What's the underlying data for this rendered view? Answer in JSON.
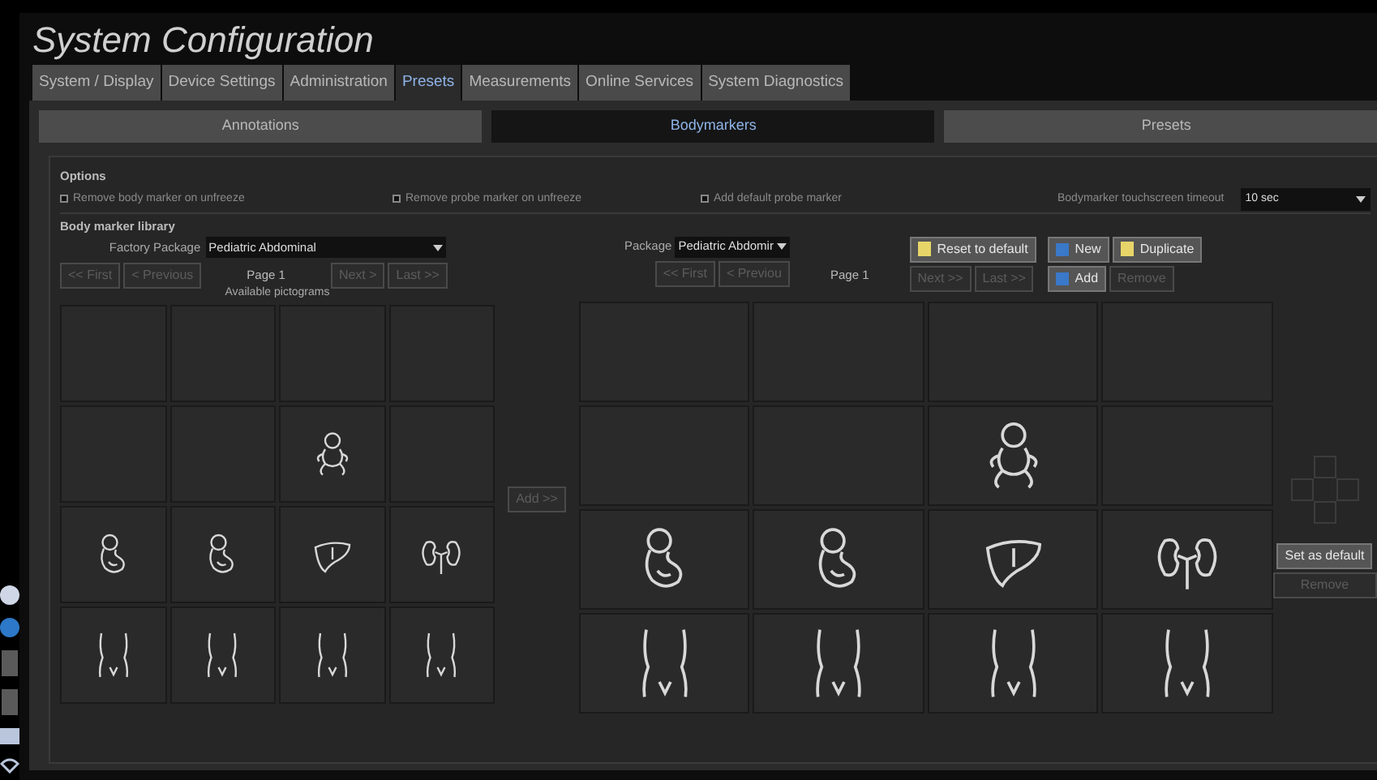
{
  "title": "System Configuration",
  "tabs": [
    {
      "label": "System / Display",
      "selected": false
    },
    {
      "label": "Device Settings",
      "selected": false
    },
    {
      "label": "Administration",
      "selected": false
    },
    {
      "label": "Presets",
      "selected": true
    },
    {
      "label": "Measurements",
      "selected": false
    },
    {
      "label": "Online Services",
      "selected": false
    },
    {
      "label": "System Diagnostics",
      "selected": false
    }
  ],
  "subtabs": [
    {
      "label": "Annotations",
      "selected": false
    },
    {
      "label": "Bodymarkers",
      "selected": true
    },
    {
      "label": "Presets",
      "selected": false
    }
  ],
  "options": {
    "heading": "Options",
    "checkboxes": [
      {
        "label": "Remove body marker on unfreeze",
        "checked": false
      },
      {
        "label": "Remove probe marker on unfreeze",
        "checked": false
      },
      {
        "label": "Add default probe marker",
        "checked": false
      }
    ],
    "timeout_label": "Bodymarker touchscreen timeout",
    "timeout_value": "10 sec"
  },
  "library": {
    "heading": "Body marker library",
    "left": {
      "package_label": "Factory Package",
      "package_value": "Pediatric Abdominal",
      "buttons": [
        {
          "label": "<< First",
          "disabled": true
        },
        {
          "label": "< Previous",
          "disabled": true
        }
      ],
      "page": "Page 1",
      "buttons_right": [
        {
          "label": "Next >",
          "disabled": true
        },
        {
          "label": "Last >>",
          "disabled": true
        }
      ],
      "caption": "Available pictograms",
      "tiles": [
        {
          "kind": "empty"
        },
        {
          "kind": "empty"
        },
        {
          "kind": "empty"
        },
        {
          "kind": "empty"
        },
        {
          "kind": "empty"
        },
        {
          "kind": "empty"
        },
        {
          "kind": "baby"
        },
        {
          "kind": "empty"
        },
        {
          "kind": "infant"
        },
        {
          "kind": "infant"
        },
        {
          "kind": "liver"
        },
        {
          "kind": "kidneys"
        },
        {
          "kind": "torso"
        },
        {
          "kind": "torso"
        },
        {
          "kind": "torso"
        },
        {
          "kind": "torso"
        }
      ]
    },
    "add_button": {
      "label": "Add >>",
      "disabled": true
    },
    "right": {
      "package_label": "Package",
      "package_value": "Pediatric Abdomir",
      "buttons": [
        {
          "label": "<< First",
          "disabled": true
        },
        {
          "label": "< Previou",
          "disabled": true
        }
      ],
      "page": "Page 1",
      "reset": {
        "label": "Reset to default",
        "disabled": false
      },
      "buttons_right": [
        {
          "label": "Next >>",
          "disabled": true
        },
        {
          "label": "Last >>",
          "disabled": true
        }
      ],
      "new": {
        "label": "New",
        "disabled": false
      },
      "duplicate": {
        "label": "Duplicate",
        "disabled": false
      },
      "add": {
        "label": "Add",
        "disabled": false
      },
      "remove_top": {
        "label": "Remove",
        "disabled": true
      },
      "tiles": [
        {
          "kind": "empty"
        },
        {
          "kind": "empty"
        },
        {
          "kind": "empty"
        },
        {
          "kind": "empty"
        },
        {
          "kind": "empty"
        },
        {
          "kind": "empty"
        },
        {
          "kind": "baby"
        },
        {
          "kind": "empty"
        },
        {
          "kind": "infant"
        },
        {
          "kind": "infant"
        },
        {
          "kind": "liver"
        },
        {
          "kind": "kidneys"
        },
        {
          "kind": "torso"
        },
        {
          "kind": "torso"
        },
        {
          "kind": "torso"
        },
        {
          "kind": "torso"
        }
      ]
    },
    "set_default": {
      "label": "Set as default",
      "disabled": false
    },
    "remove": {
      "label": "Remove",
      "disabled": true
    }
  }
}
